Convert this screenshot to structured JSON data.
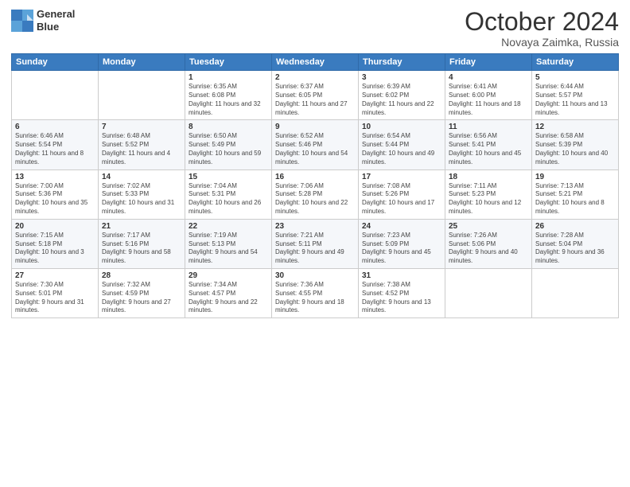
{
  "header": {
    "logo_line1": "General",
    "logo_line2": "Blue",
    "month": "October 2024",
    "location": "Novaya Zaimka, Russia"
  },
  "weekdays": [
    "Sunday",
    "Monday",
    "Tuesday",
    "Wednesday",
    "Thursday",
    "Friday",
    "Saturday"
  ],
  "weeks": [
    [
      {
        "day": "",
        "info": ""
      },
      {
        "day": "",
        "info": ""
      },
      {
        "day": "1",
        "info": "Sunrise: 6:35 AM\nSunset: 6:08 PM\nDaylight: 11 hours and 32 minutes."
      },
      {
        "day": "2",
        "info": "Sunrise: 6:37 AM\nSunset: 6:05 PM\nDaylight: 11 hours and 27 minutes."
      },
      {
        "day": "3",
        "info": "Sunrise: 6:39 AM\nSunset: 6:02 PM\nDaylight: 11 hours and 22 minutes."
      },
      {
        "day": "4",
        "info": "Sunrise: 6:41 AM\nSunset: 6:00 PM\nDaylight: 11 hours and 18 minutes."
      },
      {
        "day": "5",
        "info": "Sunrise: 6:44 AM\nSunset: 5:57 PM\nDaylight: 11 hours and 13 minutes."
      }
    ],
    [
      {
        "day": "6",
        "info": "Sunrise: 6:46 AM\nSunset: 5:54 PM\nDaylight: 11 hours and 8 minutes."
      },
      {
        "day": "7",
        "info": "Sunrise: 6:48 AM\nSunset: 5:52 PM\nDaylight: 11 hours and 4 minutes."
      },
      {
        "day": "8",
        "info": "Sunrise: 6:50 AM\nSunset: 5:49 PM\nDaylight: 10 hours and 59 minutes."
      },
      {
        "day": "9",
        "info": "Sunrise: 6:52 AM\nSunset: 5:46 PM\nDaylight: 10 hours and 54 minutes."
      },
      {
        "day": "10",
        "info": "Sunrise: 6:54 AM\nSunset: 5:44 PM\nDaylight: 10 hours and 49 minutes."
      },
      {
        "day": "11",
        "info": "Sunrise: 6:56 AM\nSunset: 5:41 PM\nDaylight: 10 hours and 45 minutes."
      },
      {
        "day": "12",
        "info": "Sunrise: 6:58 AM\nSunset: 5:39 PM\nDaylight: 10 hours and 40 minutes."
      }
    ],
    [
      {
        "day": "13",
        "info": "Sunrise: 7:00 AM\nSunset: 5:36 PM\nDaylight: 10 hours and 35 minutes."
      },
      {
        "day": "14",
        "info": "Sunrise: 7:02 AM\nSunset: 5:33 PM\nDaylight: 10 hours and 31 minutes."
      },
      {
        "day": "15",
        "info": "Sunrise: 7:04 AM\nSunset: 5:31 PM\nDaylight: 10 hours and 26 minutes."
      },
      {
        "day": "16",
        "info": "Sunrise: 7:06 AM\nSunset: 5:28 PM\nDaylight: 10 hours and 22 minutes."
      },
      {
        "day": "17",
        "info": "Sunrise: 7:08 AM\nSunset: 5:26 PM\nDaylight: 10 hours and 17 minutes."
      },
      {
        "day": "18",
        "info": "Sunrise: 7:11 AM\nSunset: 5:23 PM\nDaylight: 10 hours and 12 minutes."
      },
      {
        "day": "19",
        "info": "Sunrise: 7:13 AM\nSunset: 5:21 PM\nDaylight: 10 hours and 8 minutes."
      }
    ],
    [
      {
        "day": "20",
        "info": "Sunrise: 7:15 AM\nSunset: 5:18 PM\nDaylight: 10 hours and 3 minutes."
      },
      {
        "day": "21",
        "info": "Sunrise: 7:17 AM\nSunset: 5:16 PM\nDaylight: 9 hours and 58 minutes."
      },
      {
        "day": "22",
        "info": "Sunrise: 7:19 AM\nSunset: 5:13 PM\nDaylight: 9 hours and 54 minutes."
      },
      {
        "day": "23",
        "info": "Sunrise: 7:21 AM\nSunset: 5:11 PM\nDaylight: 9 hours and 49 minutes."
      },
      {
        "day": "24",
        "info": "Sunrise: 7:23 AM\nSunset: 5:09 PM\nDaylight: 9 hours and 45 minutes."
      },
      {
        "day": "25",
        "info": "Sunrise: 7:26 AM\nSunset: 5:06 PM\nDaylight: 9 hours and 40 minutes."
      },
      {
        "day": "26",
        "info": "Sunrise: 7:28 AM\nSunset: 5:04 PM\nDaylight: 9 hours and 36 minutes."
      }
    ],
    [
      {
        "day": "27",
        "info": "Sunrise: 7:30 AM\nSunset: 5:01 PM\nDaylight: 9 hours and 31 minutes."
      },
      {
        "day": "28",
        "info": "Sunrise: 7:32 AM\nSunset: 4:59 PM\nDaylight: 9 hours and 27 minutes."
      },
      {
        "day": "29",
        "info": "Sunrise: 7:34 AM\nSunset: 4:57 PM\nDaylight: 9 hours and 22 minutes."
      },
      {
        "day": "30",
        "info": "Sunrise: 7:36 AM\nSunset: 4:55 PM\nDaylight: 9 hours and 18 minutes."
      },
      {
        "day": "31",
        "info": "Sunrise: 7:38 AM\nSunset: 4:52 PM\nDaylight: 9 hours and 13 minutes."
      },
      {
        "day": "",
        "info": ""
      },
      {
        "day": "",
        "info": ""
      }
    ]
  ]
}
